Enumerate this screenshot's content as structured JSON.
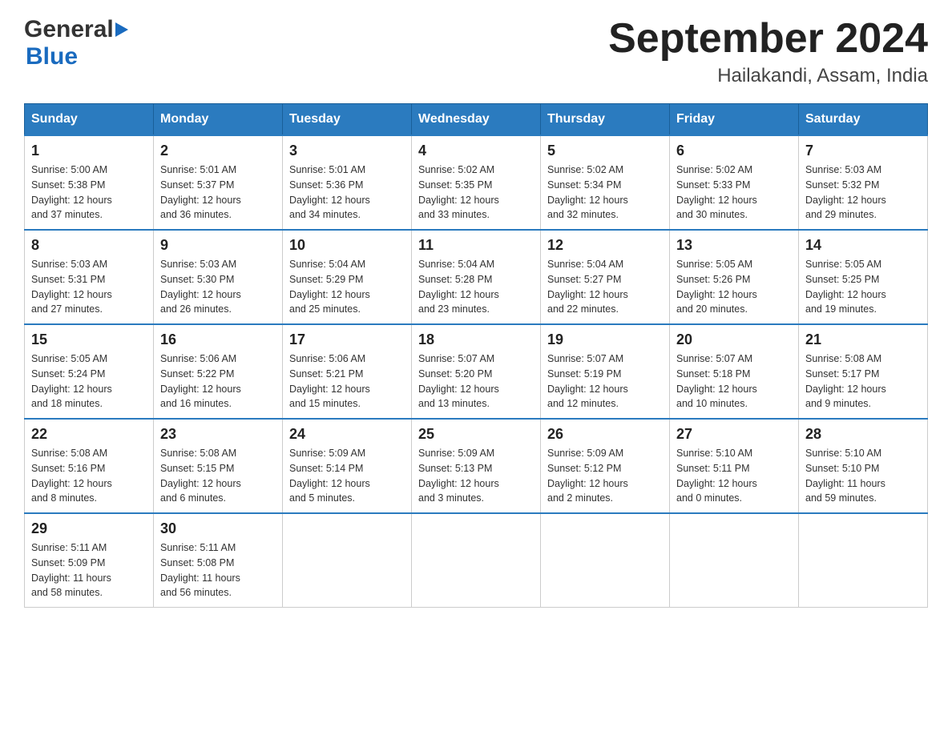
{
  "logo": {
    "general": "General",
    "blue": "Blue"
  },
  "title": "September 2024",
  "subtitle": "Hailakandi, Assam, India",
  "days": [
    "Sunday",
    "Monday",
    "Tuesday",
    "Wednesday",
    "Thursday",
    "Friday",
    "Saturday"
  ],
  "weeks": [
    [
      {
        "day": "1",
        "sunrise": "5:00 AM",
        "sunset": "5:38 PM",
        "daylight": "12 hours and 37 minutes."
      },
      {
        "day": "2",
        "sunrise": "5:01 AM",
        "sunset": "5:37 PM",
        "daylight": "12 hours and 36 minutes."
      },
      {
        "day": "3",
        "sunrise": "5:01 AM",
        "sunset": "5:36 PM",
        "daylight": "12 hours and 34 minutes."
      },
      {
        "day": "4",
        "sunrise": "5:02 AM",
        "sunset": "5:35 PM",
        "daylight": "12 hours and 33 minutes."
      },
      {
        "day": "5",
        "sunrise": "5:02 AM",
        "sunset": "5:34 PM",
        "daylight": "12 hours and 32 minutes."
      },
      {
        "day": "6",
        "sunrise": "5:02 AM",
        "sunset": "5:33 PM",
        "daylight": "12 hours and 30 minutes."
      },
      {
        "day": "7",
        "sunrise": "5:03 AM",
        "sunset": "5:32 PM",
        "daylight": "12 hours and 29 minutes."
      }
    ],
    [
      {
        "day": "8",
        "sunrise": "5:03 AM",
        "sunset": "5:31 PM",
        "daylight": "12 hours and 27 minutes."
      },
      {
        "day": "9",
        "sunrise": "5:03 AM",
        "sunset": "5:30 PM",
        "daylight": "12 hours and 26 minutes."
      },
      {
        "day": "10",
        "sunrise": "5:04 AM",
        "sunset": "5:29 PM",
        "daylight": "12 hours and 25 minutes."
      },
      {
        "day": "11",
        "sunrise": "5:04 AM",
        "sunset": "5:28 PM",
        "daylight": "12 hours and 23 minutes."
      },
      {
        "day": "12",
        "sunrise": "5:04 AM",
        "sunset": "5:27 PM",
        "daylight": "12 hours and 22 minutes."
      },
      {
        "day": "13",
        "sunrise": "5:05 AM",
        "sunset": "5:26 PM",
        "daylight": "12 hours and 20 minutes."
      },
      {
        "day": "14",
        "sunrise": "5:05 AM",
        "sunset": "5:25 PM",
        "daylight": "12 hours and 19 minutes."
      }
    ],
    [
      {
        "day": "15",
        "sunrise": "5:05 AM",
        "sunset": "5:24 PM",
        "daylight": "12 hours and 18 minutes."
      },
      {
        "day": "16",
        "sunrise": "5:06 AM",
        "sunset": "5:22 PM",
        "daylight": "12 hours and 16 minutes."
      },
      {
        "day": "17",
        "sunrise": "5:06 AM",
        "sunset": "5:21 PM",
        "daylight": "12 hours and 15 minutes."
      },
      {
        "day": "18",
        "sunrise": "5:07 AM",
        "sunset": "5:20 PM",
        "daylight": "12 hours and 13 minutes."
      },
      {
        "day": "19",
        "sunrise": "5:07 AM",
        "sunset": "5:19 PM",
        "daylight": "12 hours and 12 minutes."
      },
      {
        "day": "20",
        "sunrise": "5:07 AM",
        "sunset": "5:18 PM",
        "daylight": "12 hours and 10 minutes."
      },
      {
        "day": "21",
        "sunrise": "5:08 AM",
        "sunset": "5:17 PM",
        "daylight": "12 hours and 9 minutes."
      }
    ],
    [
      {
        "day": "22",
        "sunrise": "5:08 AM",
        "sunset": "5:16 PM",
        "daylight": "12 hours and 8 minutes."
      },
      {
        "day": "23",
        "sunrise": "5:08 AM",
        "sunset": "5:15 PM",
        "daylight": "12 hours and 6 minutes."
      },
      {
        "day": "24",
        "sunrise": "5:09 AM",
        "sunset": "5:14 PM",
        "daylight": "12 hours and 5 minutes."
      },
      {
        "day": "25",
        "sunrise": "5:09 AM",
        "sunset": "5:13 PM",
        "daylight": "12 hours and 3 minutes."
      },
      {
        "day": "26",
        "sunrise": "5:09 AM",
        "sunset": "5:12 PM",
        "daylight": "12 hours and 2 minutes."
      },
      {
        "day": "27",
        "sunrise": "5:10 AM",
        "sunset": "5:11 PM",
        "daylight": "12 hours and 0 minutes."
      },
      {
        "day": "28",
        "sunrise": "5:10 AM",
        "sunset": "5:10 PM",
        "daylight": "11 hours and 59 minutes."
      }
    ],
    [
      {
        "day": "29",
        "sunrise": "5:11 AM",
        "sunset": "5:09 PM",
        "daylight": "11 hours and 58 minutes."
      },
      {
        "day": "30",
        "sunrise": "5:11 AM",
        "sunset": "5:08 PM",
        "daylight": "11 hours and 56 minutes."
      },
      null,
      null,
      null,
      null,
      null
    ]
  ],
  "labels": {
    "sunrise": "Sunrise:",
    "sunset": "Sunset:",
    "daylight": "Daylight:"
  }
}
